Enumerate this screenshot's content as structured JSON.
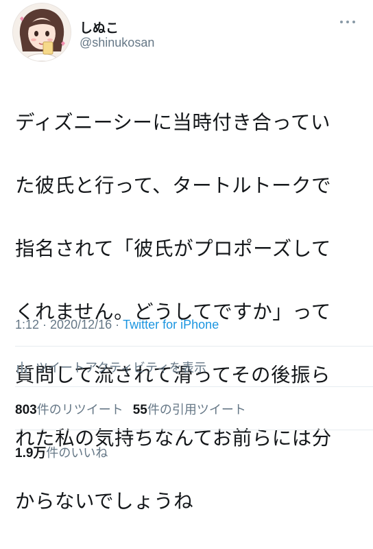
{
  "user": {
    "display_name": "しぬこ",
    "handle": "@shinukosan",
    "avatar_icon": "avatar-illustration"
  },
  "tweet": {
    "lines": [
      "ディズニーシーに当時付き合ってい",
      "た彼氏と行って、タートルトークで",
      "指名されて「彼氏がプロポーズして",
      "くれません。どうしてですか」って",
      "質問して流されて滑ってその後振ら",
      "れた私の気持ちなんてお前らには分",
      "からないでしょうね"
    ]
  },
  "meta": {
    "time": "1:12",
    "separator": "·",
    "date": "2020/12/16",
    "source": "Twitter for iPhone"
  },
  "activity": {
    "label": "ツイートアクティビティを表示",
    "icon": "bar-chart-icon"
  },
  "stats": {
    "retweets_count": "803",
    "retweets_label": "件のリツイート",
    "quotes_count": "55",
    "quotes_label": "件の引用ツイート"
  },
  "likes": {
    "count": "1.9万",
    "label": "件のいいね"
  },
  "colors": {
    "text": "#14171a",
    "secondary": "#657786",
    "link": "#1b95e0",
    "divider": "#e6ecf0"
  }
}
